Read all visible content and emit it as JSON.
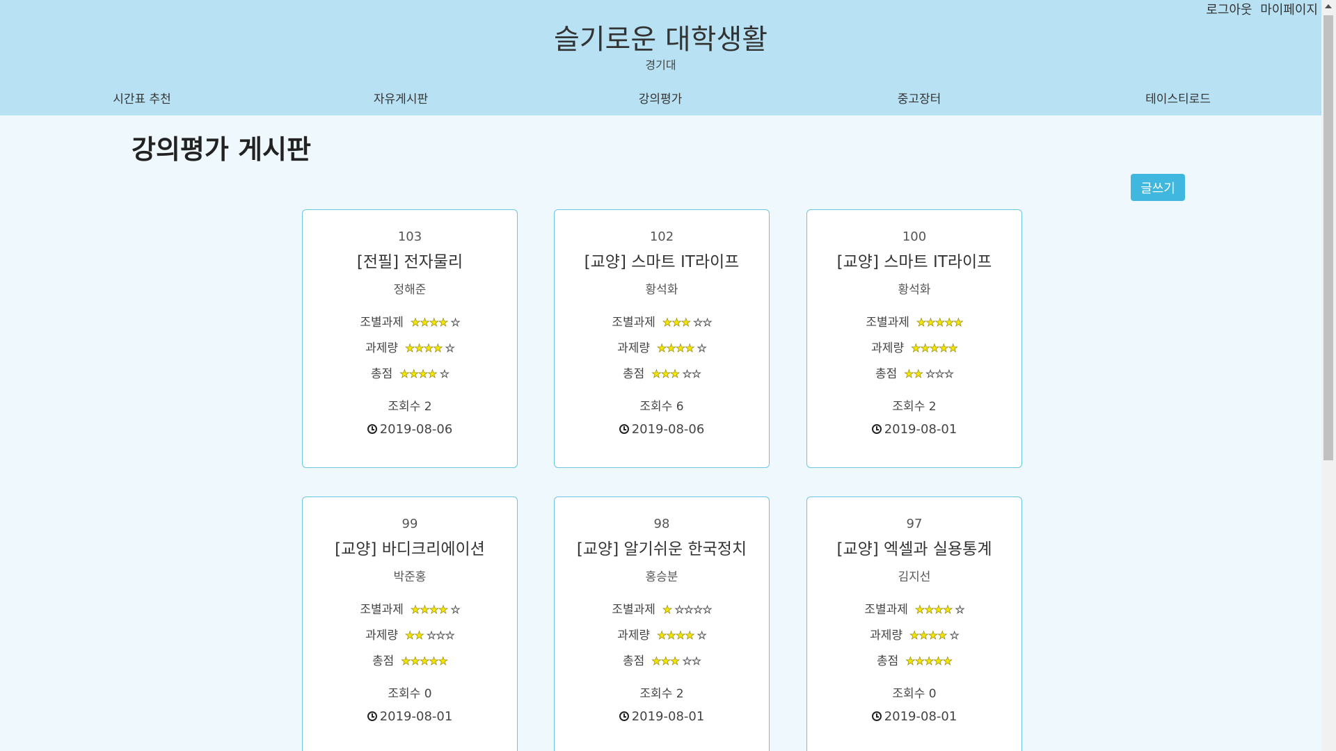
{
  "header": {
    "title": "슬기로운 대학생활",
    "subtitle": "경기대",
    "auth": {
      "logout": "로그아웃",
      "mypage": "마이페이지"
    },
    "nav": [
      "시간표 추천",
      "자유게시판",
      "강의평가",
      "중고장터",
      "테이스티로드"
    ]
  },
  "page": {
    "heading": "강의평가 게시판",
    "write_button": "글쓰기",
    "rating_labels": {
      "team": "조별과제",
      "workload": "과제량",
      "overall": "총점"
    },
    "views_label": "조회수"
  },
  "cards": [
    {
      "num": "103",
      "title": "[전필] 전자물리",
      "professor": "정해준",
      "team": 4,
      "workload": 4,
      "overall": 4,
      "views": "2",
      "date": "2019-08-06"
    },
    {
      "num": "102",
      "title": "[교양] 스마트 IT라이프",
      "professor": "황석화",
      "team": 3,
      "workload": 4,
      "overall": 3,
      "views": "6",
      "date": "2019-08-06"
    },
    {
      "num": "100",
      "title": "[교양] 스마트 IT라이프",
      "professor": "황석화",
      "team": 5,
      "workload": 5,
      "overall": 2,
      "views": "2",
      "date": "2019-08-01"
    },
    {
      "num": "99",
      "title": "[교양] 바디크리에이션",
      "professor": "박준홍",
      "team": 4,
      "workload": 2,
      "overall": 5,
      "views": "0",
      "date": "2019-08-01"
    },
    {
      "num": "98",
      "title": "[교양] 알기쉬운 한국정치",
      "professor": "홍승분",
      "team": 1,
      "workload": 4,
      "overall": 3,
      "views": "2",
      "date": "2019-08-01"
    },
    {
      "num": "97",
      "title": "[교양] 엑셀과 실용통계",
      "professor": "김지선",
      "team": 4,
      "workload": 4,
      "overall": 5,
      "views": "0",
      "date": "2019-08-01"
    }
  ],
  "colors": {
    "header_bg": "#b8e2f3",
    "page_bg": "#eef8fd",
    "accent": "#3fb7de",
    "card_border": "#6cc6e3",
    "star": "#f3e600"
  }
}
